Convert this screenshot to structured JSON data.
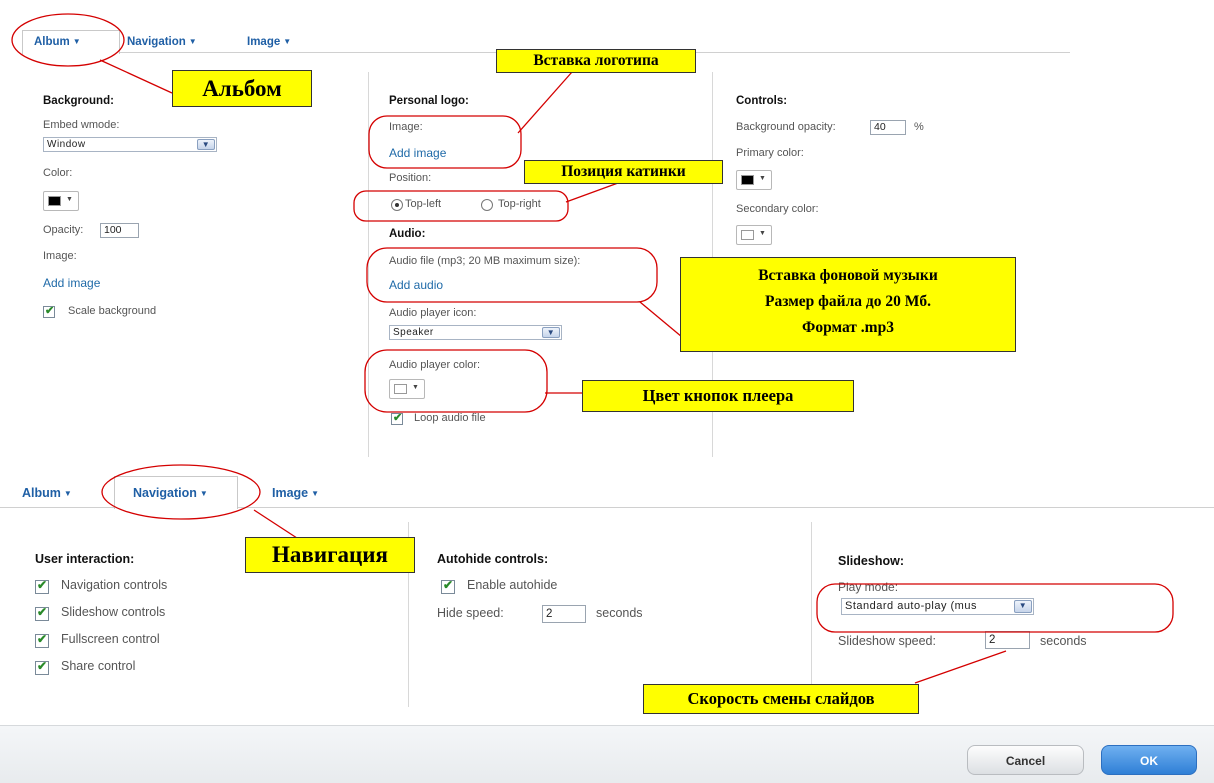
{
  "colors": {
    "tab_link": "#1f5fa5",
    "annotation_bg": "#ffff00",
    "annotation_ellipse": "#d40000",
    "ok_button": "#3a86d8"
  },
  "tabs_top": [
    {
      "label": "Album",
      "selected": true
    },
    {
      "label": "Navigation",
      "selected": false
    },
    {
      "label": "Image",
      "selected": false
    }
  ],
  "album": {
    "background": {
      "heading": "Background",
      "embed_wmode_label": "Embed wmode:",
      "embed_wmode_value": "Window",
      "color_label": "Color:",
      "color_value": "#000000",
      "opacity_label": "Opacity:",
      "opacity_value": "100",
      "image_label": "Image:",
      "add_image": "Add image",
      "scale_background": "Scale background",
      "scale_background_checked": true
    },
    "personal_logo": {
      "heading": "Personal logo",
      "image_label": "Image:",
      "add_image": "Add image",
      "position_label": "Position:",
      "position_options": [
        "Top-left",
        "Top-right"
      ],
      "position_selected": "Top-left"
    },
    "audio": {
      "heading": "Audio",
      "file_label": "Audio file (mp3; 20 MB maximum size):",
      "add_audio": "Add audio",
      "icon_label": "Audio player icon:",
      "icon_value": "Speaker",
      "color_label": "Audio player color:",
      "color_value": "#ffffff",
      "loop_label": "Loop audio file",
      "loop_checked": true
    },
    "controls": {
      "heading": "Controls",
      "bg_opacity_label": "Background opacity:",
      "bg_opacity_value": "40",
      "bg_opacity_unit": "%",
      "primary_label": "Primary color:",
      "primary_value": "#000000",
      "secondary_label": "Secondary color:",
      "secondary_value": "#ffffff"
    }
  },
  "tabs_bottom": [
    {
      "label": "Album",
      "selected": false
    },
    {
      "label": "Navigation",
      "selected": true
    },
    {
      "label": "Image",
      "selected": false
    }
  ],
  "navigation": {
    "user_interaction": {
      "heading": "User interaction",
      "items": [
        {
          "label": "Navigation controls",
          "checked": true
        },
        {
          "label": "Slideshow controls",
          "checked": true
        },
        {
          "label": "Fullscreen control",
          "checked": true
        },
        {
          "label": "Share control",
          "checked": true
        }
      ]
    },
    "autohide": {
      "heading": "Autohide controls",
      "enable_label": "Enable autohide",
      "enable_checked": true,
      "hide_speed_label": "Hide speed:",
      "hide_speed_value": "2",
      "hide_speed_unit": "seconds"
    },
    "slideshow": {
      "heading": "Slideshow",
      "play_mode_label": "Play mode:",
      "play_mode_value": "Standard auto-play (mus",
      "speed_label": "Slideshow speed:",
      "speed_value": "2",
      "speed_unit": "seconds"
    }
  },
  "footer": {
    "cancel": "Cancel",
    "ok": "OK"
  },
  "annotations": {
    "album": "Альбом",
    "logo": "Вставка логотипа",
    "position": "Позиция катинки",
    "music_lines": [
      "Вставка фоновой музыки",
      "Размер файла до 20 Мб.",
      "Формат .mp3"
    ],
    "player_color": "Цвет кнопок плеера",
    "navigation": "Навигация",
    "speed": "Скорость смены слайдов"
  },
  "icons": {
    "caret": "▾",
    "checkmark": "✔",
    "dropdown": "▼"
  }
}
